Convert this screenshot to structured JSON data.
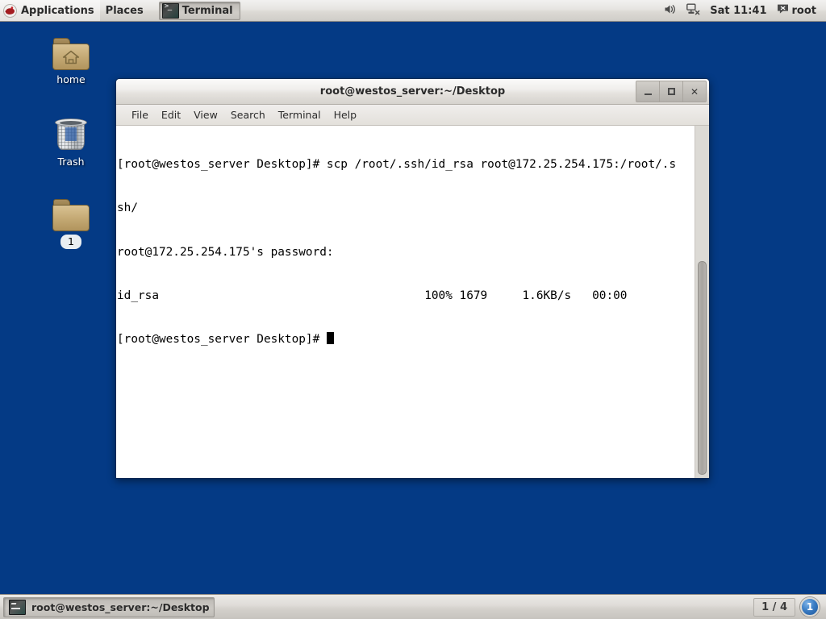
{
  "top_panel": {
    "applications_label": "Applications",
    "places_label": "Places",
    "window_list": [
      {
        "label": "Terminal",
        "icon": "terminal-icon",
        "active": true
      }
    ],
    "tray": {
      "volume_icon": "volume-icon",
      "network_icon": "network-disconnected-icon",
      "clock": "Sat 11:41",
      "user_icon": "chat-status-icon",
      "user_label": "root"
    }
  },
  "desktop": {
    "background_color": "#043a85",
    "icons": [
      {
        "label": "home",
        "icon": "home-folder-icon",
        "selected": false
      },
      {
        "label": "Trash",
        "icon": "trash-icon",
        "selected": false
      },
      {
        "label": "1",
        "icon": "folder-icon",
        "selected": true
      }
    ]
  },
  "terminal_window": {
    "title": "root@westos_server:~/Desktop",
    "controls": {
      "minimize": "minimize-icon",
      "maximize": "maximize-icon",
      "close": "✕"
    },
    "menus": [
      "File",
      "Edit",
      "View",
      "Search",
      "Terminal",
      "Help"
    ],
    "lines": [
      "[root@westos_server Desktop]# scp /root/.ssh/id_rsa root@172.25.254.175:/root/.s",
      "sh/",
      "root@172.25.254.175's password:",
      "id_rsa                                      100% 1679     1.6KB/s   00:00",
      "[root@westos_server Desktop]# "
    ],
    "cursor": "block"
  },
  "bottom_panel": {
    "tasks": [
      {
        "label": "root@westos_server:~/Desktop",
        "icon": "terminal-icon",
        "active": true
      }
    ],
    "workspace_counter": "1 / 4",
    "workspace_badge": "1"
  }
}
